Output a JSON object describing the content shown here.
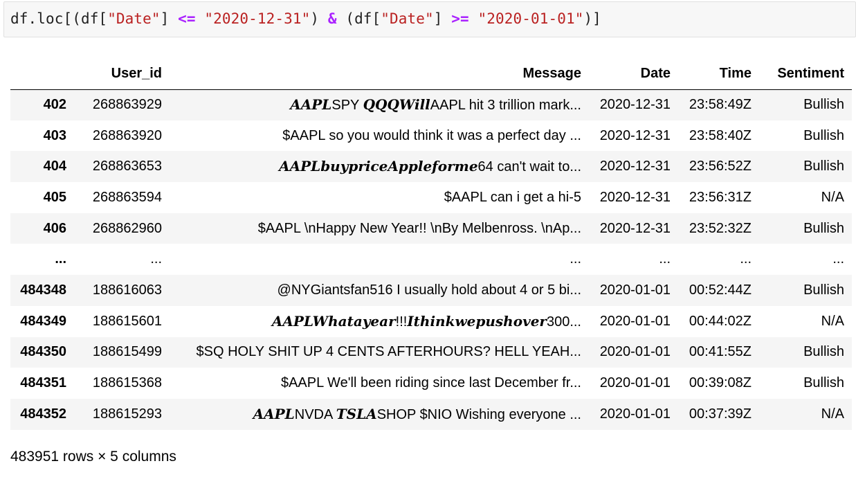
{
  "code_cell": {
    "tokens": [
      {
        "t": "df.loc[(df[",
        "k": "plain"
      },
      {
        "t": "\"Date\"",
        "k": "str"
      },
      {
        "t": "] ",
        "k": "plain"
      },
      {
        "t": "<=",
        "k": "op"
      },
      {
        "t": " ",
        "k": "plain"
      },
      {
        "t": "\"2020-12-31\"",
        "k": "str"
      },
      {
        "t": ") ",
        "k": "plain"
      },
      {
        "t": "&",
        "k": "op"
      },
      {
        "t": " (df[",
        "k": "plain"
      },
      {
        "t": "\"Date\"",
        "k": "str"
      },
      {
        "t": "] ",
        "k": "plain"
      },
      {
        "t": ">=",
        "k": "op"
      },
      {
        "t": " ",
        "k": "plain"
      },
      {
        "t": "\"2020-01-01\"",
        "k": "str"
      },
      {
        "t": ")]",
        "k": "plain"
      }
    ]
  },
  "table": {
    "columns": [
      "",
      "User_id",
      "Message",
      "Date",
      "Time",
      "Sentiment"
    ],
    "rows": [
      {
        "idx": "402",
        "user_id": "268863929",
        "message": [
          {
            "t": "AAPL",
            "m": true
          },
          {
            "t": "SPY ",
            "m": false
          },
          {
            "t": "QQQWill",
            "m": true
          },
          {
            "t": "AAPL hit 3 trillion mark...",
            "m": false
          }
        ],
        "date": "2020-12-31",
        "time": "23:58:49Z",
        "sentiment": "Bullish"
      },
      {
        "idx": "403",
        "user_id": "268863920",
        "message": [
          {
            "t": "$AAPL so you would think it was a perfect day ...",
            "m": false
          }
        ],
        "date": "2020-12-31",
        "time": "23:58:40Z",
        "sentiment": "Bullish"
      },
      {
        "idx": "404",
        "user_id": "268863653",
        "message": [
          {
            "t": "AAPLbuypriceAppleforme",
            "m": true
          },
          {
            "t": "64 can't wait to...",
            "m": false
          }
        ],
        "date": "2020-12-31",
        "time": "23:56:52Z",
        "sentiment": "Bullish"
      },
      {
        "idx": "405",
        "user_id": "268863594",
        "message": [
          {
            "t": "$AAPL can i get a hi-5",
            "m": false
          }
        ],
        "date": "2020-12-31",
        "time": "23:56:31Z",
        "sentiment": "N/A"
      },
      {
        "idx": "406",
        "user_id": "268862960",
        "message": [
          {
            "t": "$AAPL \\nHappy New Year!! \\nBy Melbenross. \\nAp...",
            "m": false
          }
        ],
        "date": "2020-12-31",
        "time": "23:52:32Z",
        "sentiment": "Bullish"
      },
      {
        "idx": "...",
        "user_id": "...",
        "message": [
          {
            "t": "...",
            "m": false
          }
        ],
        "date": "...",
        "time": "...",
        "sentiment": "..."
      },
      {
        "idx": "484348",
        "user_id": "188616063",
        "message": [
          {
            "t": "@NYGiantsfan516 I usually hold about 4 or 5 bi...",
            "m": false
          }
        ],
        "date": "2020-01-01",
        "time": "00:52:44Z",
        "sentiment": "Bullish"
      },
      {
        "idx": "484349",
        "user_id": "188615601",
        "message": [
          {
            "t": "AAPLWhatayear",
            "m": true
          },
          {
            "t": "!!!",
            "m": false
          },
          {
            "t": "Ithinkwepushover",
            "m": true
          },
          {
            "t": "300...",
            "m": false
          }
        ],
        "date": "2020-01-01",
        "time": "00:44:02Z",
        "sentiment": "N/A"
      },
      {
        "idx": "484350",
        "user_id": "188615499",
        "message": [
          {
            "t": "$SQ HOLY SHIT UP 4 CENTS AFTERHOURS? HELL YEAH...",
            "m": false
          }
        ],
        "date": "2020-01-01",
        "time": "00:41:55Z",
        "sentiment": "Bullish"
      },
      {
        "idx": "484351",
        "user_id": "188615368",
        "message": [
          {
            "t": "$AAPL We'll been riding since last December fr...",
            "m": false
          }
        ],
        "date": "2020-01-01",
        "time": "00:39:08Z",
        "sentiment": "Bullish"
      },
      {
        "idx": "484352",
        "user_id": "188615293",
        "message": [
          {
            "t": "AAPL",
            "m": true
          },
          {
            "t": "NVDA ",
            "m": false
          },
          {
            "t": "TSLA",
            "m": true
          },
          {
            "t": "SHOP $NIO Wishing everyone ...",
            "m": false
          }
        ],
        "date": "2020-01-01",
        "time": "00:37:39Z",
        "sentiment": "N/A"
      }
    ]
  },
  "shape_info": "483951 rows × 5 columns"
}
